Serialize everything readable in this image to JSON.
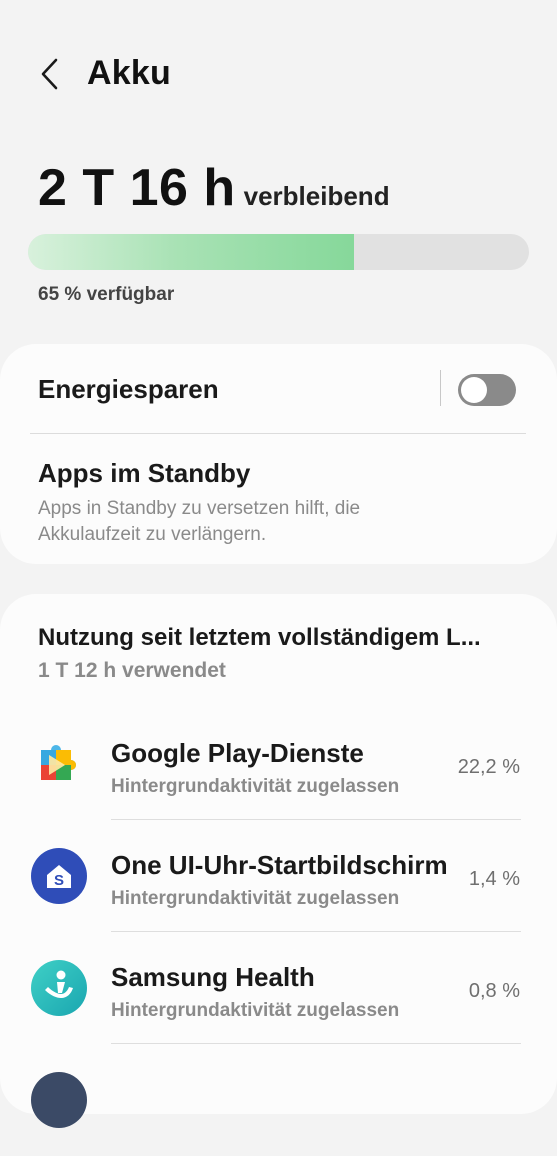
{
  "header": {
    "title": "Akku",
    "back_icon": "chevron-left-icon"
  },
  "battery": {
    "remaining_time": "2 T 16 h",
    "remaining_label": "verbleibend",
    "level_fraction": 0.65,
    "available_text": "65 % verfügbar",
    "bar_color": "#86d89a"
  },
  "power_saving": {
    "label": "Energiesparen",
    "toggle_on": false
  },
  "standby": {
    "title": "Apps im Standby",
    "description": "Apps in Standby zu versetzen hilft, die Akkulaufzeit zu verlängern."
  },
  "usage": {
    "title": "Nutzung seit letztem vollständigem L...",
    "used_time": "1 T 12 h verwendet",
    "apps": [
      {
        "name": "Google Play-Dienste",
        "status": "Hintergrundaktivität zugelassen",
        "percent": "22,2 %",
        "icon": "google-play-services-icon"
      },
      {
        "name": "One UI-Uhr-Startbildschirm",
        "status": "Hintergrundaktivität zugelassen",
        "percent": "1,4 %",
        "icon": "one-ui-watch-home-icon"
      },
      {
        "name": "Samsung Health",
        "status": "Hintergrundaktivität zugelassen",
        "percent": "0,8 %",
        "icon": "samsung-health-icon"
      }
    ]
  }
}
